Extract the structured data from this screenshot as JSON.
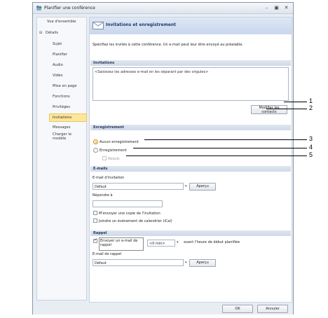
{
  "window": {
    "title": "Planifier une conférence"
  },
  "nav": {
    "items": [
      {
        "label": "Vue d'ensemble"
      },
      {
        "label": "Détails",
        "expander": "⊟"
      },
      {
        "label": "Sujet"
      },
      {
        "label": "Planifier"
      },
      {
        "label": "Audio"
      },
      {
        "label": "Vidéo"
      },
      {
        "label": "Mise en page"
      },
      {
        "label": "Fonctions"
      },
      {
        "label": "Privilèges"
      },
      {
        "label": "Invitations"
      },
      {
        "label": "Messages"
      },
      {
        "label": "Charger le modèle"
      }
    ]
  },
  "header": {
    "title": "Invitations et enregistrement",
    "description": "Spécifiez les invités à cette conférence.  Un e-mail peut leur être envoyé au préalable."
  },
  "invitations": {
    "section": "Invitations",
    "placeholder": "<Saisissez les adresses e-mail en les séparant par des virgules>",
    "modify_contacts": "Modifier les contacts"
  },
  "registration": {
    "section": "Enregistrement",
    "none": "Aucun enregistrement",
    "registration": "Enregistrement",
    "required": "Requis"
  },
  "emails": {
    "section": "E-mails",
    "invitation_label": "E-mail d'invitation",
    "invitation_value": "Défaut",
    "preview": "Aperçu",
    "reply_label": "Répondre à",
    "copy_me": "M'envoyer une copie de l'invitation",
    "calendar": "Joindre un événement de calendrier (iCal)"
  },
  "reminder": {
    "section": "Rappel",
    "send_email": "Envoyer un e-mail de rappel",
    "minutes": "<0 min>",
    "before": "avant l'heure de début planifiée",
    "email_label": "E-mail de rappel",
    "email_value": "Défaut",
    "preview": "Aperçu"
  },
  "footer": {
    "ok": "OK",
    "cancel": "Annuler"
  },
  "callouts": [
    "1",
    "2",
    "3",
    "4",
    "5"
  ],
  "colors": {
    "nav_selected": "#fde69a",
    "section_header": "#d6dfec",
    "radio_selected": "#f0a030"
  }
}
